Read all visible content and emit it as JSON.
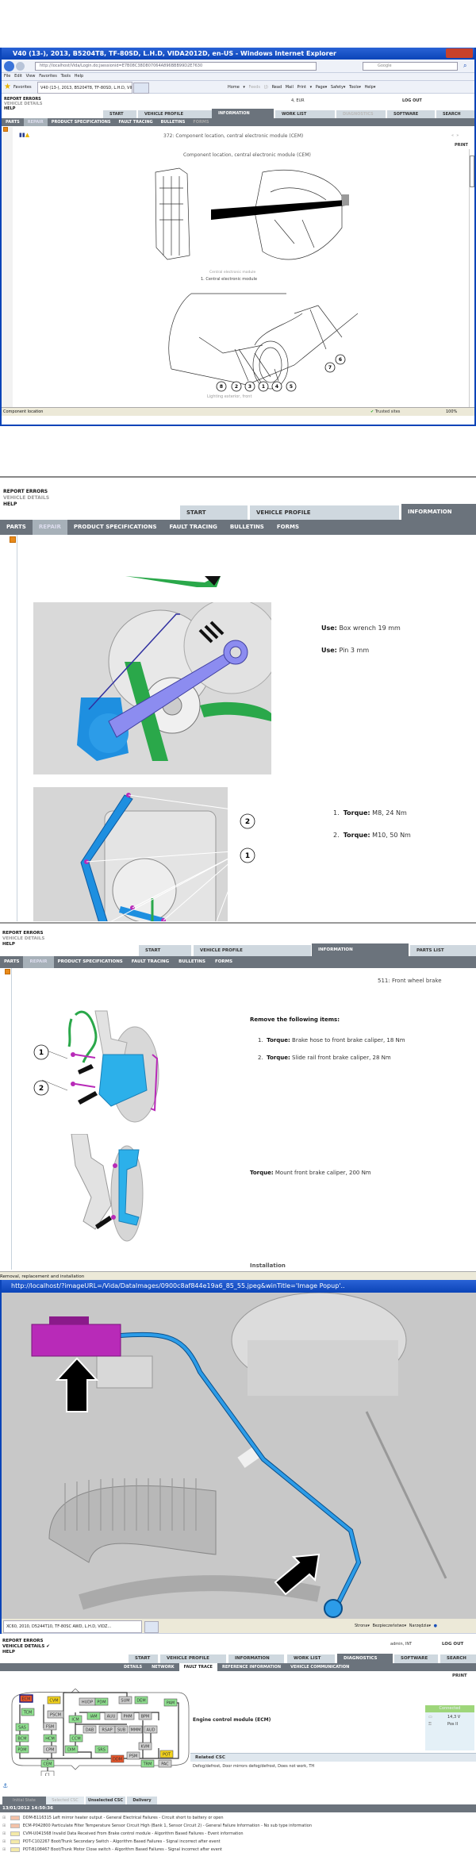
{
  "s1": {
    "window_title": "V40 (13-), 2013, B5204T8, TF-80SD, L.H.D, VIDA2012D, en-US - Windows Internet Explorer",
    "url": "http://localhost/Vida/Login.do;jsessionid=E7B08C38D807064A896BBB99D2E7630",
    "search_placeholder": "Google",
    "menu": [
      "File",
      "Edit",
      "View",
      "Favorites",
      "Tools",
      "Help"
    ],
    "favorites": "Favorites",
    "browser_tab": "V40 (13-), 2013, B5204T8, TF-80SD, L.H.D, VIDA201...",
    "cmd": [
      "Home",
      "Feeds (J)",
      "Read Mail",
      "Print",
      "Page",
      "Safety",
      "Tools",
      "Help"
    ],
    "side": [
      "REPORT ERRORS",
      "VEHICLE DETAILS",
      "HELP"
    ],
    "user": "4, EUR",
    "logout": "LOG OUT",
    "tabs": [
      "START",
      "VEHICLE PROFILE",
      "INFORMATION",
      "WORK LIST",
      "DIAGNOSTICS",
      "SOFTWARE",
      "SEARCH"
    ],
    "subnav": [
      "PARTS",
      "REPAIR",
      "PRODUCT SPECIFICATIONS",
      "FAULT TRACING",
      "BULLETINS",
      "FORMS"
    ],
    "doc_title": "372: Component location, central electronic module (CEM)",
    "print": "PRINT",
    "heading": "Component location, central electronic module (CEM)",
    "caption": "Central electronic module",
    "item1": "1.  Central electronic module",
    "callouts": [
      "8",
      "2",
      "3",
      "1",
      "4",
      "5",
      "7",
      "6"
    ],
    "caption2": "Lighting exterior, front",
    "status": "Component location",
    "zone": "Trusted sites",
    "zoom": "100%"
  },
  "s2": {
    "side": [
      "REPORT ERRORS",
      "VEHICLE DETAILS",
      "HELP"
    ],
    "tabs": [
      "START",
      "VEHICLE PROFILE",
      "INFORMATION"
    ],
    "subnav": [
      "PARTS",
      "REPAIR",
      "PRODUCT SPECIFICATIONS",
      "FAULT TRACING",
      "BULLETINS",
      "FORMS"
    ],
    "use1_label": "Use:",
    "use1": "Box wrench 19 mm",
    "use2_label": "Use:",
    "use2": "Pin 3 mm",
    "torque": [
      {
        "n": "1.",
        "label": "Torque:",
        "value": "M8, 24 Nm"
      },
      {
        "n": "2.",
        "label": "Torque:",
        "value": "M10, 50 Nm"
      }
    ],
    "callouts": [
      "2",
      "1"
    ]
  },
  "s3": {
    "side": [
      "REPORT ERRORS",
      "VEHICLE DETAILS",
      "HELP"
    ],
    "tabs": [
      "START",
      "VEHICLE PROFILE",
      "INFORMATION",
      "PARTS LIST"
    ],
    "subnav": [
      "PARTS",
      "REPAIR",
      "PRODUCT SPECIFICATIONS",
      "FAULT TRACING",
      "BULLETINS",
      "FORMS"
    ],
    "doc_title": "511: Front wheel brake",
    "remove_heading": "Remove the following items:",
    "items": [
      {
        "n": "1.",
        "label": "Torque:",
        "value": "Brake hose to front brake caliper, 18 Nm"
      },
      {
        "n": "2.",
        "label": "Torque:",
        "value": "Slide rail front brake caliper, 28 Nm"
      }
    ],
    "mount_label": "Torque:",
    "mount": "Mount front brake caliper, 200 Nm",
    "installation": "Installation",
    "callouts": [
      "1",
      "2"
    ],
    "status": "Removal, replacement and installation"
  },
  "s4": {
    "popup_title": "http://localhost/?imageURL=/Vida/DataImages/0900c8af844e19a6_85_55.jpeg&winTitle='Image Popup'..",
    "browser_tab": "XC60, 2010, D5244T10, TF-80SC AWD, L.H.D, VIDZ...",
    "cmd": [
      "Strona",
      "Bezpieczeństwo",
      "Narzędzia"
    ]
  },
  "s5": {
    "side": [
      "REPORT ERRORS",
      "VEHICLE DETAILS ✔",
      "HELP"
    ],
    "user": "admin, INT",
    "logout": "LOG OUT",
    "tabs": [
      "START",
      "VEHICLE PROFILE",
      "INFORMATION",
      "WORK LIST",
      "DIAGNOSTICS",
      "SOFTWARE",
      "SEARCH"
    ],
    "subnav": [
      "DETAILS",
      "NETWORK",
      "FAULT TRACE",
      "REFERENCE INFORMATION",
      "VEHICLE COMMUNICATION"
    ],
    "print": "PRINT",
    "module_title": "Engine control module (ECM)",
    "connected": "Connected",
    "voltage": "14,3 V",
    "ignition": "Pos II",
    "related_csc": "Related CSC",
    "csc_text": "Defog/defrost, Door mirrors defog/defrost, Does not work, TH",
    "modules": [
      {
        "name": "ECM",
        "status": "fault"
      },
      {
        "name": "CVM",
        "status": "warn"
      },
      {
        "name": "TCM",
        "status": "ok"
      },
      {
        "name": "PSCM",
        "status": "none"
      },
      {
        "name": "HUDP",
        "status": "none"
      },
      {
        "name": "PDM",
        "status": "ok"
      },
      {
        "name": "SUM",
        "status": "none"
      },
      {
        "name": "DEM",
        "status": "ok"
      },
      {
        "name": "PAM",
        "status": "ok"
      },
      {
        "name": "SAS",
        "status": "ok"
      },
      {
        "name": "FSM",
        "status": "none"
      },
      {
        "name": "ICM",
        "status": "ok"
      },
      {
        "name": "IAM",
        "status": "ok"
      },
      {
        "name": "AUU",
        "status": "none"
      },
      {
        "name": "PHM",
        "status": "none"
      },
      {
        "name": "BPM",
        "status": "none"
      },
      {
        "name": "BCM",
        "status": "ok"
      },
      {
        "name": "HCM",
        "status": "ok"
      },
      {
        "name": "DAB",
        "status": "none"
      },
      {
        "name": "RSAP",
        "status": "none"
      },
      {
        "name": "SUB",
        "status": "none"
      },
      {
        "name": "MMM",
        "status": "none"
      },
      {
        "name": "AUD",
        "status": "none"
      },
      {
        "name": "CCM",
        "status": "ok"
      },
      {
        "name": "PDM2",
        "label": "PDM",
        "status": "ok"
      },
      {
        "name": "CPM",
        "status": "none"
      },
      {
        "name": "DIM",
        "status": "ok"
      },
      {
        "name": "SRS",
        "status": "ok"
      },
      {
        "name": "KVM",
        "status": "none"
      },
      {
        "name": "DDM",
        "status": "fault"
      },
      {
        "name": "PSM",
        "status": "none"
      },
      {
        "name": "POT",
        "status": "warn"
      },
      {
        "name": "CEM",
        "status": "ok"
      },
      {
        "name": "TRM",
        "status": "ok"
      },
      {
        "name": "PAC",
        "status": "none"
      },
      {
        "name": "C1",
        "status": "plain"
      }
    ],
    "status_colors": {
      "ok": "#8fe08f",
      "warn": "#f2d21c",
      "fault": "#e8552a",
      "none": "#cfcfcf",
      "plain": "#ffffff"
    },
    "bottom_tabs": [
      "Initial State",
      "Selected CSC",
      "Unselected CSC",
      "Delivery"
    ],
    "timestamp": "13/01/2012 14:50:36",
    "dtcs": [
      {
        "code": "DDM-B116315",
        "text": "Left mirror heater output - General Electrical Failures - Circuit short to battery or open",
        "sev": "red"
      },
      {
        "code": "ECM-P042800",
        "text": "Particulate Filter Temperature Sensor Circuit High (Bank 1, Sensor Circuit 2) - General Failure Information - No sub type information",
        "sev": "red"
      },
      {
        "code": "CVM-U041568",
        "text": "Invalid Data Received From Brake control module - Algorithm Based Failures - Event information",
        "sev": "yellow"
      },
      {
        "code": "POT-C102267",
        "text": "Boot/Trunk Secondary Switch - Algorithm Based Failures - Signal incorrect after event",
        "sev": "yellow"
      },
      {
        "code": "POT-B108467",
        "text": "Boot/Trunk Motor Close switch - Algorithm Based Failures - Signal incorrect after event",
        "sev": "yellow"
      }
    ]
  }
}
